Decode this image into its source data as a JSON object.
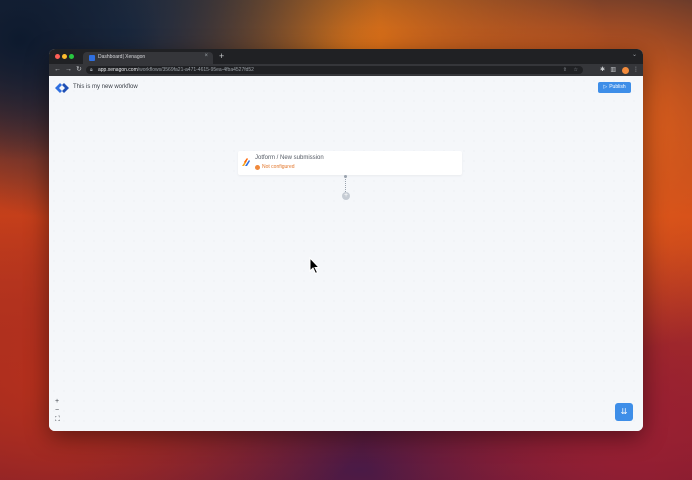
{
  "browser": {
    "tab": {
      "title": "Dashboard| Xenagon",
      "close_label": "×"
    },
    "new_tab_label": "+",
    "tab_menu_label": "⌄",
    "nav": {
      "back": "←",
      "forward": "→",
      "reload": "↻"
    },
    "url": {
      "host": "app.xenagon.com",
      "path": "/workflows/3569fa21-a471-4615-95ea-4fba4527fd52"
    }
  },
  "app": {
    "workflow_title": "This is my new workflow",
    "publish_label": "Publish",
    "publish_icon": "▷"
  },
  "canvas": {
    "node": {
      "title": "Jotform / New submission",
      "status": "Not configured",
      "status_color": "#f0893b"
    },
    "add_step_label": "+",
    "zoom_in_label": "+",
    "zoom_out_label": "−",
    "fit_view_label": "⛶",
    "fab_icon": "⇊"
  },
  "colors": {
    "accent": "#3e8ee8",
    "warning": "#f0893b"
  },
  "icons": [
    "xenagon-logo",
    "jotform-icon",
    "lock-icon",
    "share-icon",
    "star-icon",
    "extensions-icon",
    "sidepanel-icon",
    "menu-dots-icon"
  ]
}
